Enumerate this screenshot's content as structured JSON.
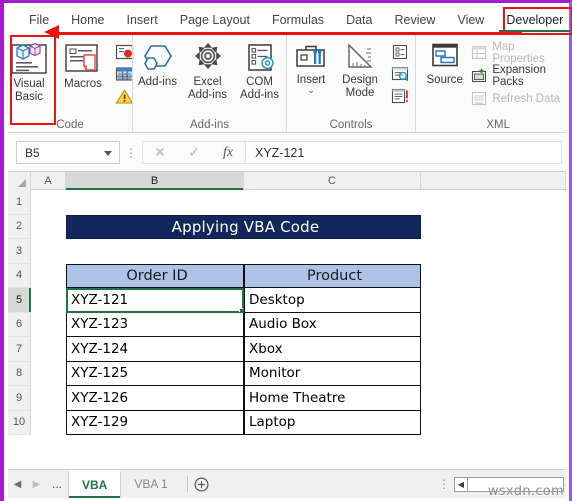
{
  "ribbon": {
    "tabs": [
      {
        "label": "File",
        "active": false
      },
      {
        "label": "Home",
        "active": false
      },
      {
        "label": "Insert",
        "active": false
      },
      {
        "label": "Page Layout",
        "active": false
      },
      {
        "label": "Formulas",
        "active": false
      },
      {
        "label": "Data",
        "active": false
      },
      {
        "label": "Review",
        "active": false
      },
      {
        "label": "View",
        "active": false
      },
      {
        "label": "Developer",
        "active": true
      }
    ],
    "groups": {
      "code": {
        "label": "Code",
        "visual_basic": "Visual Basic",
        "macros": "Macros",
        "record_macro_icon": "record-macro-icon",
        "relative_references_icon": "use-relative-references-icon",
        "macro_security_icon": "macro-security-icon"
      },
      "addins": {
        "label": "Add-ins",
        "addins": "Add-ins",
        "excel_addins": "Excel Add-ins",
        "com_addins": "COM Add-ins"
      },
      "controls": {
        "label": "Controls",
        "insert": "Insert",
        "design_mode": "Design Mode",
        "properties_icon": "properties-icon",
        "view_code_icon": "view-code-icon",
        "run_dialog_icon": "run-dialog-icon"
      },
      "xml": {
        "label": "XML",
        "source": "Source",
        "map_properties": "Map Properties",
        "expansion_packs": "Expansion Packs",
        "refresh_data": "Refresh Data"
      }
    }
  },
  "formula_bar": {
    "name_box_value": "B5",
    "cancel_icon": "✕",
    "enter_icon": "✓",
    "fx_label": "fx",
    "formula_value": "XYZ-121",
    "menu_dots": "⋮"
  },
  "grid": {
    "columns": [
      "A",
      "B",
      "C"
    ],
    "rows": [
      "1",
      "2",
      "3",
      "4",
      "5",
      "6",
      "7",
      "8",
      "9",
      "10"
    ],
    "selected_cell": "B5",
    "selected_row": "5",
    "selected_column": "B",
    "title_cell": "Applying VBA Code",
    "table_headers": [
      "Order ID",
      "Product"
    ],
    "table_rows": [
      [
        "XYZ-121",
        "Desktop"
      ],
      [
        "XYZ-123",
        "Audio Box"
      ],
      [
        "XYZ-124",
        "Xbox"
      ],
      [
        "XYZ-125",
        "Monitor"
      ],
      [
        "XYZ-126",
        "Home Theatre"
      ],
      [
        "XYZ-129",
        "Laptop"
      ]
    ],
    "colors": {
      "title_bg": "#12285c",
      "title_fg": "#ffffff",
      "header_bg": "#aec3e8",
      "selection": "#217346"
    }
  },
  "sheet_bar": {
    "first_arrow": "◀",
    "last_arrow": "▶",
    "ellipsis": "...",
    "tabs": [
      {
        "label": "VBA",
        "active": true
      },
      {
        "label": "VBA 1",
        "active": false
      }
    ],
    "add_sheet": "+",
    "menu_dots": "⋮",
    "scroll_left": "◀"
  },
  "annotations": {
    "highlight_color": "#e81313",
    "developer_callout": "Developer",
    "visual_basic_callout": "Visual Basic"
  },
  "watermark": "wsxdn.com"
}
